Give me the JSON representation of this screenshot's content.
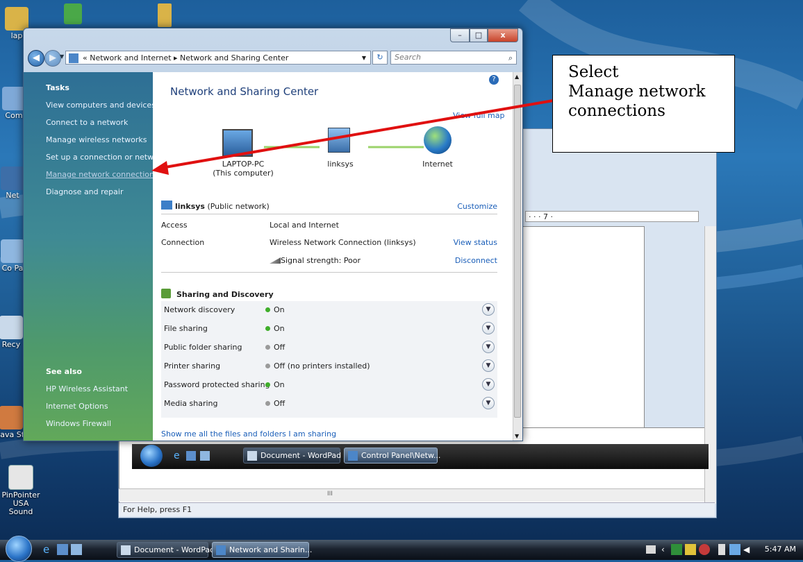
{
  "desktop": {
    "icons": [
      {
        "label": "lap"
      },
      {
        "label": "Com"
      },
      {
        "label": "Net"
      },
      {
        "label": "Co Pa"
      },
      {
        "label": "Recy"
      },
      {
        "label": "Java St"
      },
      {
        "label": "PinPointer USA Sound"
      }
    ]
  },
  "wordpad": {
    "ruler_text": "· · · 7 ·",
    "status": "For Help, press F1",
    "scroll_mark": "III"
  },
  "mini_taskbar": {
    "items": [
      {
        "label": "Document - WordPad"
      },
      {
        "label": "Control Panel\\Netw..."
      }
    ]
  },
  "window": {
    "breadcrumb": "« Network and Internet ▸ Network and Sharing Center",
    "search_placeholder": "Search",
    "tasks_heading": "Tasks",
    "tasks": [
      {
        "label": "View computers and devices"
      },
      {
        "label": "Connect to a network"
      },
      {
        "label": "Manage wireless networks"
      },
      {
        "label": "Set up a connection or network"
      },
      {
        "label": "Manage network connections"
      },
      {
        "label": "Diagnose and repair"
      }
    ],
    "see_also_heading": "See also",
    "see_also": [
      {
        "label": "HP Wireless Assistant"
      },
      {
        "label": "Internet Options"
      },
      {
        "label": "Windows Firewall"
      }
    ],
    "title": "Network and Sharing Center",
    "view_full_map": "View full map",
    "nodes": [
      {
        "label": "LAPTOP-PC",
        "sub": "(This computer)"
      },
      {
        "label": "linksys"
      },
      {
        "label": "Internet"
      }
    ],
    "network": {
      "name": "linksys",
      "type": "(Public network)",
      "customize": "Customize",
      "rows": [
        {
          "key": "Access",
          "value": "Local and Internet",
          "action": ""
        },
        {
          "key": "Connection",
          "value": "Wireless Network Connection (linksys)",
          "action": "View status"
        },
        {
          "key": "",
          "value": "Signal strength:  Poor",
          "action": "Disconnect"
        }
      ]
    },
    "sharing_heading": "Sharing and Discovery",
    "sharing": [
      {
        "key": "Network discovery",
        "value": "On",
        "state": "on"
      },
      {
        "key": "File sharing",
        "value": "On",
        "state": "on"
      },
      {
        "key": "Public folder sharing",
        "value": "Off",
        "state": "off"
      },
      {
        "key": "Printer sharing",
        "value": "Off (no printers installed)",
        "state": "off"
      },
      {
        "key": "Password protected sharing",
        "value": "On",
        "state": "on"
      },
      {
        "key": "Media sharing",
        "value": "Off",
        "state": "off"
      }
    ],
    "show_files": "Show me all the files and folders I am sharing"
  },
  "callout": {
    "lines": [
      "Select",
      "Manage network",
      "connections"
    ]
  },
  "taskbar": {
    "items": [
      {
        "label": "Document - WordPad"
      },
      {
        "label": "Network and Sharin..."
      }
    ],
    "clock": "5:47 AM"
  },
  "colors": {
    "on_dot": "#3fae2a",
    "off_dot": "#9a9a9a",
    "arrow": "#e01010",
    "link": "#1a5eb8"
  }
}
